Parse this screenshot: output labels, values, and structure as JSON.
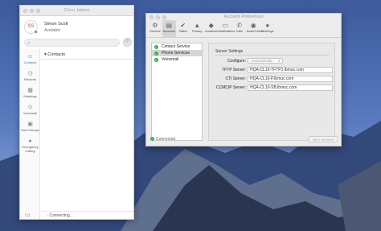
{
  "jabber": {
    "title": "Cisco Jabber",
    "initials": "SS",
    "user_name": "Simon Scott",
    "presence": "Available",
    "search_placeholder": "Search or call",
    "nav": [
      {
        "label": "Contacts",
        "icon": "person-icon"
      },
      {
        "label": "Recents",
        "icon": "clock-icon"
      },
      {
        "label": "Meetings",
        "icon": "calendar-icon"
      },
      {
        "label": "Voicemail",
        "icon": "voicemail-icon"
      },
      {
        "label": "Hunt Groups",
        "icon": "hunt-group-icon"
      },
      {
        "label": "Emergency Calling",
        "icon": "globe-icon"
      }
    ],
    "contacts_header": "Contacts",
    "status_text": "Connecting..."
  },
  "prefs": {
    "title": "Accounts Preferences",
    "toolbar": [
      {
        "label": "General",
        "icon": "gear-icon"
      },
      {
        "label": "Accounts",
        "icon": "accounts-icon"
      },
      {
        "label": "Status",
        "icon": "status-icon"
      },
      {
        "label": "Privacy",
        "icon": "lock-icon"
      },
      {
        "label": "Locations",
        "icon": "location-icon"
      },
      {
        "label": "Notifications",
        "icon": "notifications-icon"
      },
      {
        "label": "Calls",
        "icon": "phone-icon"
      },
      {
        "label": "Audio/Video",
        "icon": "audio-video-icon"
      },
      {
        "label": "Meetings",
        "icon": "meetings-icon"
      }
    ],
    "services": [
      "Contact Service",
      "Phone Services",
      "Voicemail"
    ],
    "selected_service": "Phone Services",
    "section_title": "Server Settings",
    "configure_label": "Configure:",
    "configure_value": "Automatically",
    "tftp_label": "TFTP Server:",
    "tftp_value": "HQA-CL10-TFTP1.lbmuc.com",
    "cti_label": "CTI Server:",
    "cti_value": "HQA-CL10-P.lbmuc.com",
    "ccmcip_label": "CCMCIP Server:",
    "ccmcip_value": "HQA-CL10-SB.lbmuc.com",
    "connection_status": "Connected",
    "new_session_label": "New Session"
  },
  "colors": {
    "available": "#3aa64a",
    "accent": "#2a7ad6"
  }
}
